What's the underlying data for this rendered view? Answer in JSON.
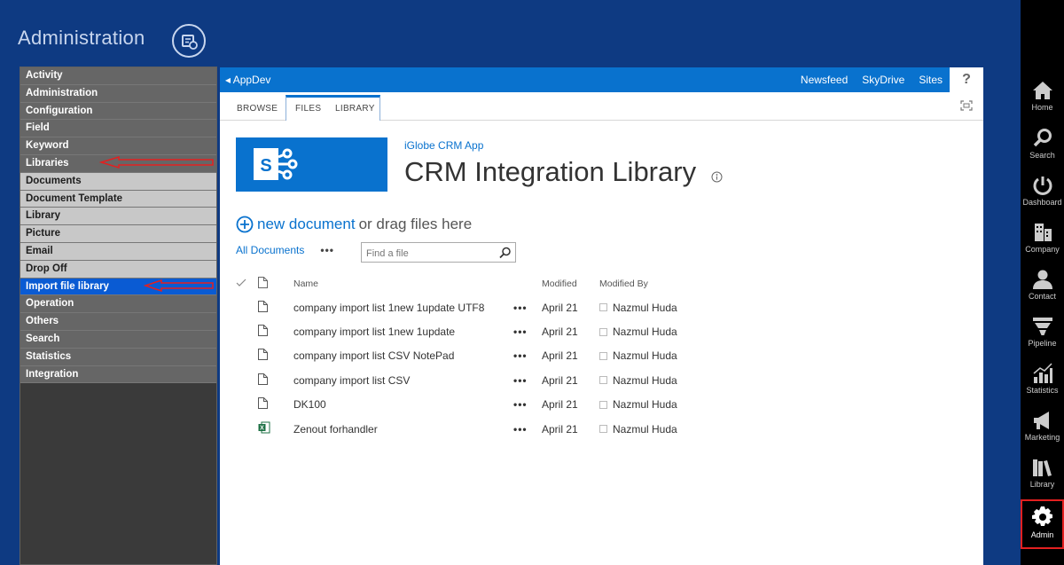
{
  "header": {
    "title": "Administration"
  },
  "left_menu": {
    "items": [
      {
        "label": "Activity",
        "style": "dark"
      },
      {
        "label": "Administration",
        "style": "dark"
      },
      {
        "label": "Configuration",
        "style": "dark"
      },
      {
        "label": "Field",
        "style": "dark"
      },
      {
        "label": "Keyword",
        "style": "dark"
      },
      {
        "label": "Libraries",
        "style": "dark"
      },
      {
        "label": "Documents",
        "style": "light"
      },
      {
        "label": "Document Template",
        "style": "light"
      },
      {
        "label": "Library",
        "style": "light"
      },
      {
        "label": "Picture",
        "style": "light"
      },
      {
        "label": "Email",
        "style": "light"
      },
      {
        "label": "Drop Off",
        "style": "light"
      },
      {
        "label": "Import file library",
        "style": "active"
      },
      {
        "label": "Operation",
        "style": "dark"
      },
      {
        "label": "Others",
        "style": "dark"
      },
      {
        "label": "Search",
        "style": "dark"
      },
      {
        "label": "Statistics",
        "style": "dark"
      },
      {
        "label": "Integration",
        "style": "dark"
      }
    ]
  },
  "sharepoint": {
    "site_link": "AppDev",
    "top_nav": [
      "Newsfeed",
      "SkyDrive",
      "Sites"
    ],
    "help": "?",
    "ribbon_tabs": [
      "BROWSE",
      "FILES",
      "LIBRARY"
    ],
    "app_name": "iGlobe CRM App",
    "library_title": "CRM Integration Library",
    "new_document_link": "new document",
    "new_document_rest": "or drag files here",
    "view_name": "All Documents",
    "view_more": "•••",
    "search_placeholder": "Find a file",
    "columns": {
      "name": "Name",
      "modified": "Modified",
      "modified_by": "Modified By"
    },
    "documents": [
      {
        "name": "company import list 1new 1update UTF8",
        "icon": "file-icon",
        "modified": "April 21",
        "modified_by": "Nazmul Huda"
      },
      {
        "name": "company import list 1new 1update",
        "icon": "file-icon",
        "modified": "April 21",
        "modified_by": "Nazmul Huda"
      },
      {
        "name": "company import list CSV NotePad",
        "icon": "file-icon",
        "modified": "April 21",
        "modified_by": "Nazmul Huda"
      },
      {
        "name": "company import list CSV",
        "icon": "file-icon",
        "modified": "April 21",
        "modified_by": "Nazmul Huda"
      },
      {
        "name": "DK100",
        "icon": "file-icon",
        "modified": "April 21",
        "modified_by": "Nazmul Huda"
      },
      {
        "name": "Zenout forhandler",
        "icon": "excel-icon",
        "modified": "April 21",
        "modified_by": "Nazmul Huda"
      }
    ],
    "row_menu": "•••"
  },
  "right_nav": {
    "items": [
      {
        "label": "Home",
        "icon": "home-icon"
      },
      {
        "label": "Search",
        "icon": "search-icon"
      },
      {
        "label": "Dashboard",
        "icon": "dashboard-icon"
      },
      {
        "label": "Company",
        "icon": "company-icon"
      },
      {
        "label": "Contact",
        "icon": "contact-icon"
      },
      {
        "label": "Pipeline",
        "icon": "pipeline-icon"
      },
      {
        "label": "Statistics",
        "icon": "statistics-icon"
      },
      {
        "label": "Marketing",
        "icon": "marketing-icon"
      },
      {
        "label": "Library",
        "icon": "library-icon"
      },
      {
        "label": "Admin",
        "icon": "gear-icon"
      }
    ]
  },
  "colors": {
    "background": "#0e3a82",
    "accent": "#0972ce",
    "active_menu": "#0a5bd3",
    "annotation_red": "#e32020"
  }
}
